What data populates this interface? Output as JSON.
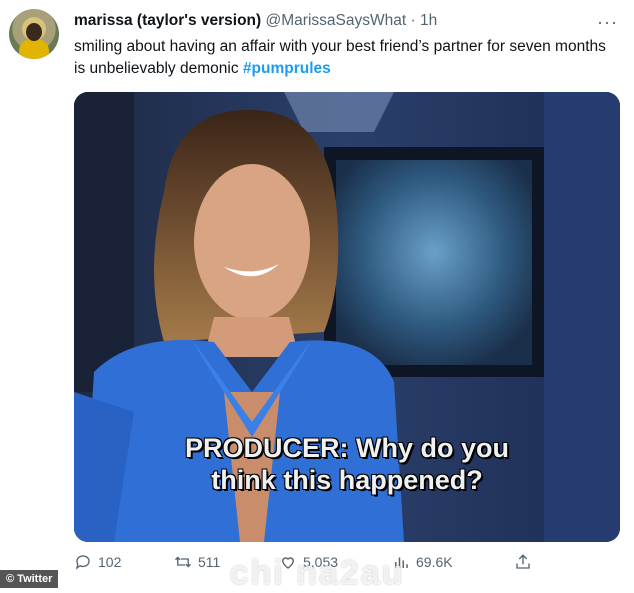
{
  "tweet": {
    "display_name": "marissa (taylor's version)",
    "handle": "@MarissaSaysWhat",
    "separator": "·",
    "time": "1h",
    "text": "smiling about having an affair with your best friend’s partner for seven months is unbelievably demonic",
    "hashtag": "#pumprules",
    "media_caption_line1": "PRODUCER: Why do you",
    "media_caption_line2": "think this happened?",
    "more_icon": "more-icon"
  },
  "actions": {
    "reply_count": "102",
    "retweet_count": "511",
    "like_count": "5,053",
    "views_count": "69.6K"
  },
  "watermark": "chi na2au",
  "source": "Twitter"
}
